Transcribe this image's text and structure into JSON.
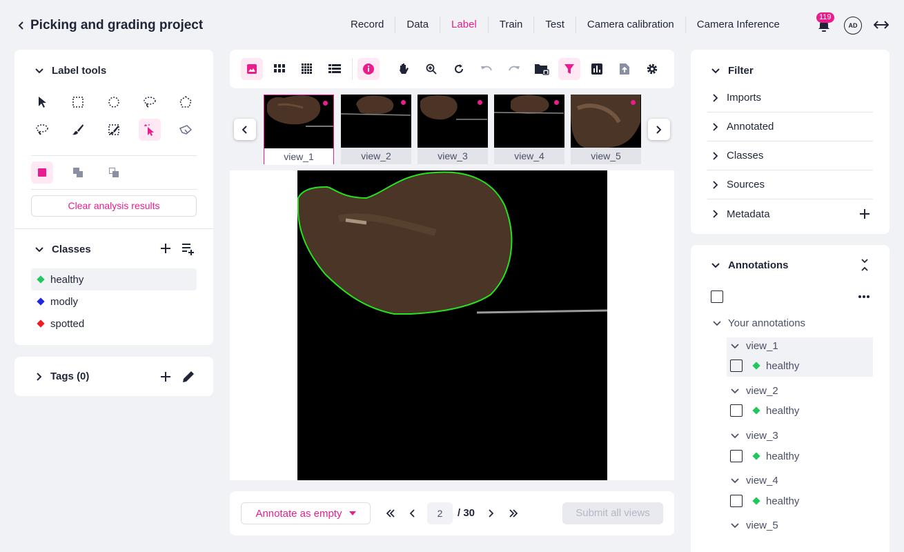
{
  "header": {
    "title": "Picking and grading project",
    "nav": [
      "Record",
      "Data",
      "Label",
      "Train",
      "Test",
      "Camera calibration",
      "Camera Inference"
    ],
    "active_nav": "Label",
    "notification_count": "119",
    "avatar_initials": "AD"
  },
  "left_panel": {
    "label_tools_title": "Label tools",
    "clear_button": "Clear analysis results",
    "classes_title": "Classes",
    "classes": [
      {
        "name": "healthy",
        "color": "#22c55e"
      },
      {
        "name": "modly",
        "color": "#1d28e0"
      },
      {
        "name": "spotted",
        "color": "#ee1c24"
      }
    ],
    "tags_title": "Tags (0)"
  },
  "thumbnails": [
    "view_1",
    "view_2",
    "view_3",
    "view_4",
    "view_5"
  ],
  "bottom_bar": {
    "annotate_empty": "Annotate as empty",
    "page_value": "2",
    "page_total": "/ 30",
    "submit": "Submit all views"
  },
  "right_panel": {
    "filter_title": "Filter",
    "filters": [
      "Imports",
      "Annotated",
      "Classes",
      "Sources",
      "Metadata"
    ],
    "annotations_title": "Annotations",
    "your_annotations": "Your annotations",
    "views": [
      {
        "name": "view_1",
        "label": "healthy"
      },
      {
        "name": "view_2",
        "label": "healthy"
      },
      {
        "name": "view_3",
        "label": "healthy"
      },
      {
        "name": "view_4",
        "label": "healthy"
      },
      {
        "name": "view_5",
        "label": ""
      }
    ]
  },
  "colors": {
    "accent": "#e91e8c",
    "healthy": "#22c55e"
  }
}
